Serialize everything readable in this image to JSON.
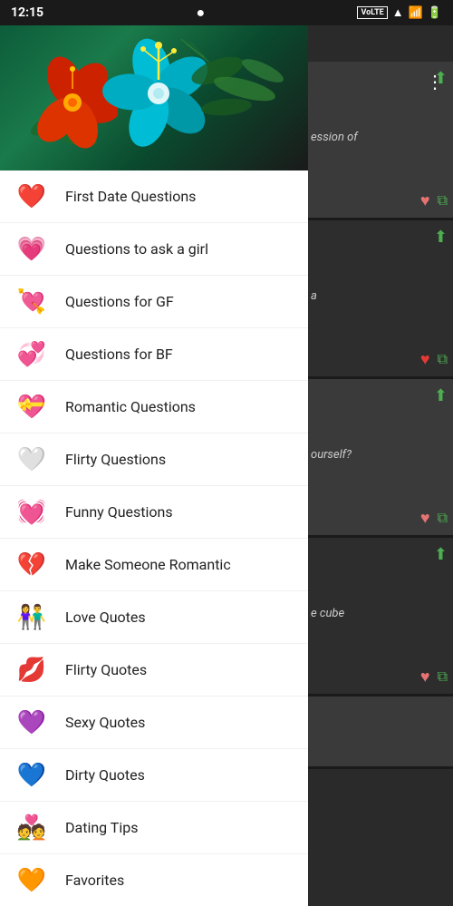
{
  "statusBar": {
    "time": "12:15",
    "networkBadge": "VoLTE",
    "recordIcon": "●"
  },
  "drawer": {
    "menuItems": [
      {
        "id": "first-date-questions",
        "label": "First Date Questions",
        "icon": "❤️"
      },
      {
        "id": "questions-to-ask-a-girl",
        "label": "Questions to ask a girl",
        "icon": "💗"
      },
      {
        "id": "questions-for-gf",
        "label": "Questions for GF",
        "icon": "💘"
      },
      {
        "id": "questions-for-bf",
        "label": "Questions for BF",
        "icon": "💞"
      },
      {
        "id": "romantic-questions",
        "label": "Romantic Questions",
        "icon": "💝"
      },
      {
        "id": "flirty-questions",
        "label": "Flirty Questions",
        "icon": "🤍"
      },
      {
        "id": "funny-questions",
        "label": "Funny Questions",
        "icon": "💓"
      },
      {
        "id": "make-someone-romantic",
        "label": "Make Someone Romantic",
        "icon": "💔"
      },
      {
        "id": "love-quotes",
        "label": "Love Quotes",
        "icon": "👫"
      },
      {
        "id": "flirty-quotes",
        "label": "Flirty Quotes",
        "icon": "💋"
      },
      {
        "id": "sexy-quotes",
        "label": "Sexy Quotes",
        "icon": "💜"
      },
      {
        "id": "dirty-quotes",
        "label": "Dirty Quotes",
        "icon": "💙"
      },
      {
        "id": "dating-tips",
        "label": "Dating Tips",
        "icon": "💑"
      },
      {
        "id": "favorites",
        "label": "Favorites",
        "icon": "🧡"
      }
    ]
  },
  "contentCards": [
    {
      "text": "ession of",
      "hasShare": true,
      "hasHeart": true,
      "hasCopy": true
    },
    {
      "text": "a",
      "hasShare": true,
      "hasHeart": true,
      "hasCopy": true
    },
    {
      "text": "ourself?",
      "hasShare": true,
      "hasHeart": true,
      "hasCopy": true
    },
    {
      "text": "e cube",
      "hasShare": true,
      "hasHeart": true,
      "hasCopy": true
    },
    {
      "text": "",
      "hasShare": false,
      "hasHeart": false,
      "hasCopy": false
    }
  ],
  "threeDotsMenu": "⋮"
}
